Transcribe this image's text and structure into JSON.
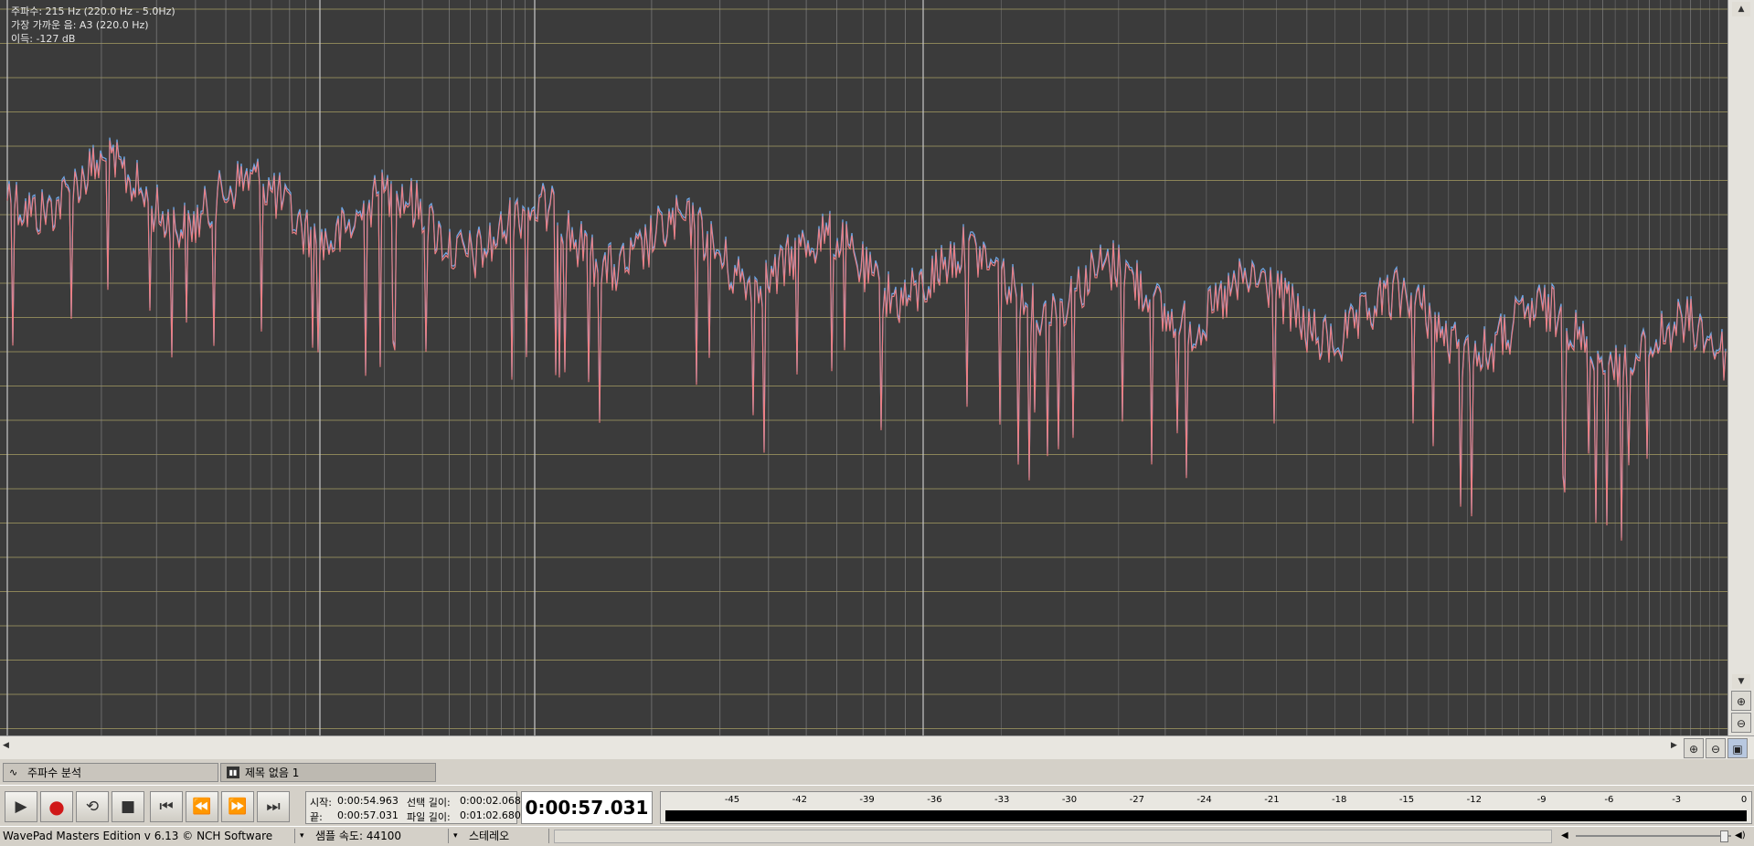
{
  "analyzer": {
    "info_lines": [
      "주파수: 215 Hz (220.0 Hz - 5.0Hz)",
      "가장 가까운 음: A3 (220.0 Hz)",
      "이득: -127 dB"
    ],
    "colors": {
      "background": "#3b3b3b",
      "grid_h": "#8b8458",
      "grid_v": "#8c8c8c",
      "grid_v_major": "#c8c8c8",
      "trace_left": "#6fa8e8",
      "trace_right": "#ee7f84"
    }
  },
  "tabs": [
    {
      "icon": "spectrum-icon",
      "label": "주파수 분석"
    },
    {
      "icon": "waveform-icon",
      "label": "제목 없음 1"
    }
  ],
  "transport": {
    "buttons": [
      "play",
      "record",
      "play-loop",
      "stop",
      "skip-to-start",
      "rewind",
      "fast-forward",
      "skip-to-end"
    ],
    "start_label": "시작:",
    "start_value": "0:00:54.963",
    "end_label": "끝:",
    "end_value": "0:00:57.031",
    "sel_len_label": "선택 길이:",
    "sel_len_value": "0:00:02.068",
    "file_len_label": "파일 길이:",
    "file_len_value": "0:01:02.680",
    "current_time": "0:00:57.031"
  },
  "level_meter": {
    "ticks": [
      "-45",
      "-42",
      "-39",
      "-36",
      "-33",
      "-30",
      "-27",
      "-24",
      "-21",
      "-18",
      "-15",
      "-12",
      "-9",
      "-6",
      "-3",
      "0"
    ]
  },
  "status": {
    "app": "WavePad Masters Edition v 6.13 © NCH Software",
    "sample_rate": "샘플 속도: 44100",
    "channels": "스테레오"
  }
}
